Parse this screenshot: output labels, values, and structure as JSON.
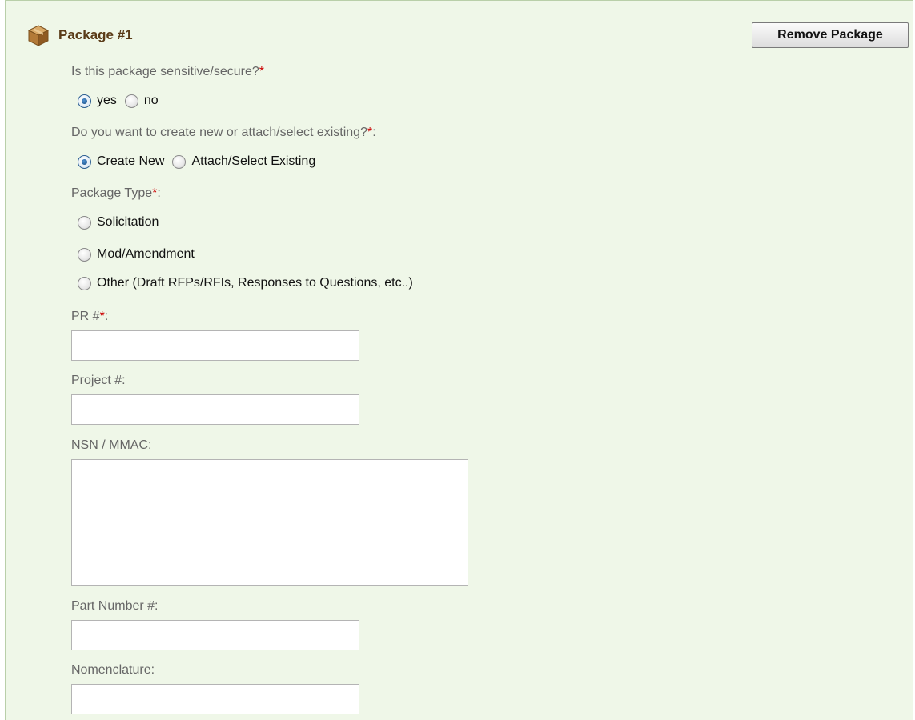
{
  "package": {
    "title": "Package #1",
    "icon": "package-box-icon",
    "remove_label": "Remove Package"
  },
  "sensitive": {
    "label": "Is this package sensitive/secure?",
    "required_mark": "*",
    "options": [
      "yes",
      "no"
    ],
    "selected": "yes"
  },
  "create_mode": {
    "label": "Do you want to create new or attach/select existing?",
    "required_mark": "*",
    "suffix": ":",
    "options": [
      "Create New",
      "Attach/Select Existing"
    ],
    "selected": "Create New"
  },
  "package_type": {
    "label": "Package Type",
    "required_mark": "*",
    "suffix": ":",
    "options": [
      "Solicitation",
      "Mod/Amendment",
      "Other (Draft RFPs/RFIs, Responses to Questions, etc..)"
    ],
    "selected": ""
  },
  "pr_number": {
    "label": "PR #",
    "required_mark": "*",
    "suffix": ":",
    "value": ""
  },
  "project_number": {
    "label": "Project #:",
    "value": ""
  },
  "nsn_mmac": {
    "label": "NSN / MMAC:",
    "value": ""
  },
  "part_number": {
    "label": "Part Number #:",
    "value": ""
  },
  "nomenclature": {
    "label": "Nomenclature:",
    "value": ""
  },
  "colors": {
    "panel_bg": "#eff7e8",
    "title": "#5a3b17",
    "label": "#666666",
    "required": "#cc0000"
  }
}
